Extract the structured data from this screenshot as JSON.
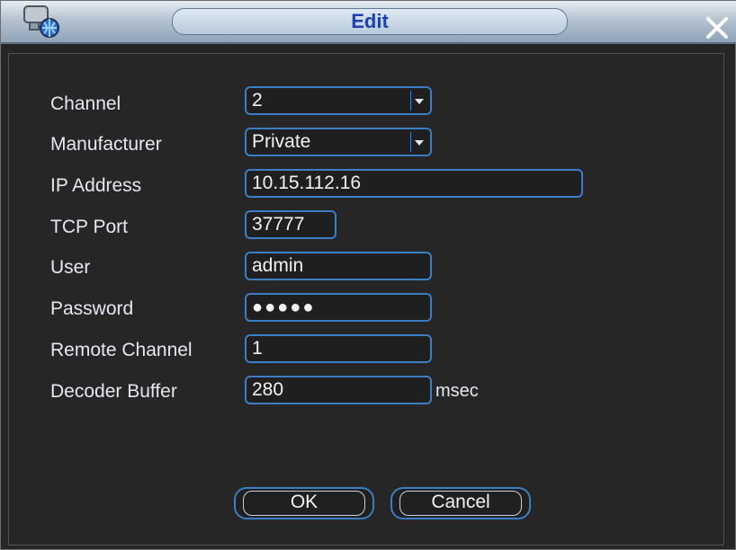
{
  "window": {
    "title": "Edit"
  },
  "form": {
    "channel": {
      "label": "Channel",
      "value": "2"
    },
    "manufacturer": {
      "label": "Manufacturer",
      "value": "Private"
    },
    "ip": {
      "label": "IP Address",
      "value": "10.15.112.16"
    },
    "tcp_port": {
      "label": "TCP Port",
      "value": "37777"
    },
    "user": {
      "label": "User",
      "value": "admin"
    },
    "password": {
      "label": "Password",
      "value": "●●●●●"
    },
    "remote_channel": {
      "label": "Remote Channel",
      "value": "1"
    },
    "decoder_buffer": {
      "label": "Decoder Buffer",
      "value": "280",
      "unit": "msec"
    }
  },
  "buttons": {
    "ok": "OK",
    "cancel": "Cancel"
  },
  "colors": {
    "accent": "#3a7fc5",
    "title_text": "#1d3fb3",
    "background": "#262626"
  },
  "icons": {
    "app": "camera-globe-icon",
    "close": "close-icon",
    "dropdown": "chevron-down-icon"
  }
}
